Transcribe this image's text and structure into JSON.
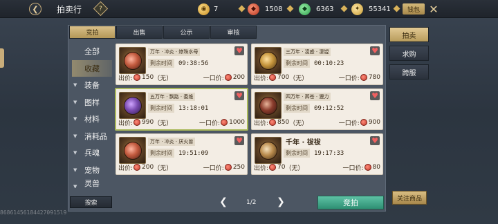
{
  "header": {
    "title": "拍卖行",
    "help_glyph": "?",
    "wallet_label": "钱包",
    "currencies": [
      {
        "name": "copper-coin-icon",
        "value": "7"
      },
      {
        "name": "red-gem-icon",
        "value": "1508"
      },
      {
        "name": "jade-icon",
        "value": "6363"
      },
      {
        "name": "gold-leaf-icon",
        "value": "55341"
      }
    ]
  },
  "top_tabs": [
    {
      "label": "竞拍",
      "active": true
    },
    {
      "label": "出售",
      "active": false
    },
    {
      "label": "公示",
      "active": false
    },
    {
      "label": "审核",
      "active": false
    }
  ],
  "categories": [
    {
      "label": "全部",
      "expandable": false,
      "active": false
    },
    {
      "label": "收藏",
      "expandable": false,
      "active": true
    },
    {
      "label": "装备",
      "expandable": true,
      "active": false
    },
    {
      "label": "图样",
      "expandable": true,
      "active": false
    },
    {
      "label": "材料",
      "expandable": true,
      "active": false
    },
    {
      "label": "消耗品",
      "expandable": true,
      "active": false
    },
    {
      "label": "兵魂",
      "expandable": true,
      "active": false
    },
    {
      "label": "宠物",
      "expandable": true,
      "active": false
    },
    {
      "label": "灵兽",
      "expandable": true,
      "active": false
    }
  ],
  "search_label": "搜索",
  "labels": {
    "remaining": "剩余时间",
    "bid": "出价:",
    "buyout": "一口价:"
  },
  "items": [
    {
      "name": "万年 · 冲炎 · 燎珠水母",
      "time": "09:38:56",
      "bid": "150",
      "bid_note": "（无）",
      "buyout": "200",
      "icon": "rose",
      "selected": false,
      "big": false
    },
    {
      "name": "三万年 · 凌惑 · 凄镗",
      "time": "00:10:23",
      "bid": "700",
      "bid_note": "（无）",
      "buyout": "780",
      "icon": "gold",
      "selected": false,
      "big": false
    },
    {
      "name": "五万年 · 飘路 · 委维",
      "time": "13:18:01",
      "bid": "990",
      "bid_note": "（无）",
      "buyout": "1000",
      "icon": "violet",
      "selected": true,
      "big": false
    },
    {
      "name": "四万年 · 葬苍 · 狸力",
      "time": "09:12:52",
      "bid": "850",
      "bid_note": "（无）",
      "buyout": "900",
      "icon": "wine",
      "selected": false,
      "big": false
    },
    {
      "name": "万年 · 冲炎 · 厌火兽",
      "time": "19:51:09",
      "bid": "200",
      "bid_note": "（无）",
      "buyout": "250",
      "icon": "rose",
      "selected": false,
      "big": false
    },
    {
      "name": "千年 · 祓祓",
      "time": "19:17:33",
      "bid": "70",
      "bid_note": "（无）",
      "buyout": "80",
      "icon": "amber",
      "selected": false,
      "big": true
    }
  ],
  "pager": {
    "text": "1/2"
  },
  "bid_button": "竞拍",
  "right_tabs": [
    {
      "label": "拍卖",
      "active": true
    },
    {
      "label": "求购",
      "active": false
    },
    {
      "label": "跨服",
      "active": false
    }
  ],
  "follow_button": "关注商品",
  "watermark": "868614561844270915l9"
}
